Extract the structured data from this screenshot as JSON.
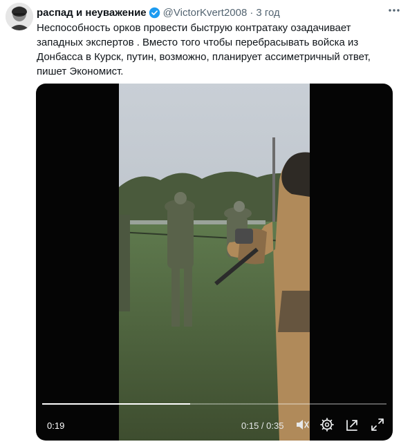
{
  "author": {
    "name": "распад и неуважение",
    "handle": "@VictorKvert2008",
    "separator": "·",
    "time": "3 год"
  },
  "tweet": {
    "text_lines": [
      "Неспособность орков провести быструю контратаку озадачивает",
      "западных экспертов . Вместо того чтобы перебрасывать войска из",
      "Донбасса в Курск, путин, возможно, планирует ассиметричный ответ,",
      "пишет Экономист."
    ]
  },
  "video": {
    "remaining_badge": "0:19",
    "elapsed": "0:15",
    "duration": "0:35",
    "time_display": "0:15 / 0:35",
    "progress": 0.43
  },
  "icons": {
    "verified": "verified-badge-icon",
    "more": "more-icon",
    "volume": "volume-icon",
    "settings": "settings-icon",
    "popout": "popout-icon",
    "fullscreen": "fullscreen-icon"
  },
  "colors": {
    "verified_blue": "#1d9bf0",
    "secondary_text": "#536471",
    "primary_text": "#0f1419"
  }
}
